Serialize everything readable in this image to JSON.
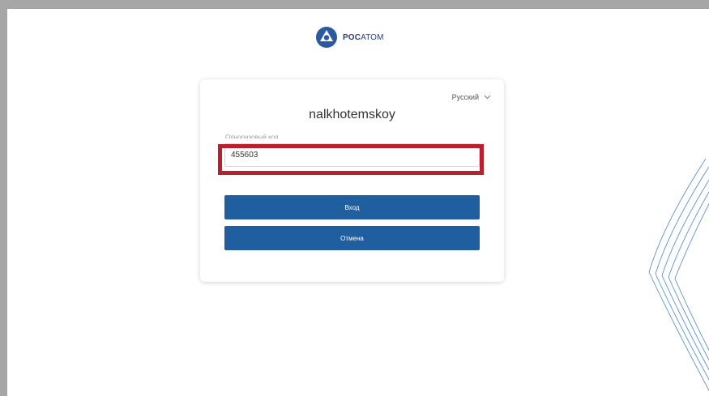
{
  "brand": {
    "name_bold": "РОС",
    "name_light": "АТОМ",
    "logo_icon": "rosatom-logo-icon",
    "color": "#2a3f70"
  },
  "login": {
    "language": "Русский",
    "username": "nalkhotemskoy",
    "code_label": "Одноразовый код",
    "code_value": "455603",
    "login_button": "Вход",
    "cancel_button": "Отмена"
  },
  "colors": {
    "button": "#1f5fa0",
    "highlight": "#b8202e",
    "frame": "#a6a6a6"
  }
}
